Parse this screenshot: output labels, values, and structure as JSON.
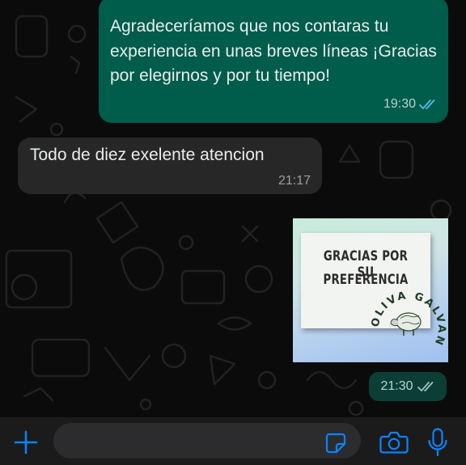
{
  "messages": [
    {
      "direction": "outgoing",
      "text": "Agradeceríamos que nos contaras tu experiencia en unas breves líneas ¡Gracias por elegirnos y por tu tiempo!",
      "time": "19:30",
      "status": "read"
    },
    {
      "direction": "incoming",
      "text": "Todo de diez exelente atencion",
      "time": "21:17"
    },
    {
      "direction": "outgoing",
      "type": "image",
      "image_text": [
        "GRACIAS POR SU",
        "PREFERENCIA"
      ],
      "image_logo": "OLIVA GALVANIZADOS",
      "time": "21:30",
      "status": "read"
    }
  ],
  "composer": {
    "message_value": "",
    "attach_icon": "plus-icon",
    "sticker_icon": "sticker-icon",
    "camera_icon": "camera-icon",
    "mic_icon": "microphone-icon"
  },
  "colors": {
    "outgoing_bubble": "#005c4b",
    "incoming_bubble": "#272727",
    "accent_blue": "#0a84ff",
    "read_check": "#53bdeb"
  }
}
